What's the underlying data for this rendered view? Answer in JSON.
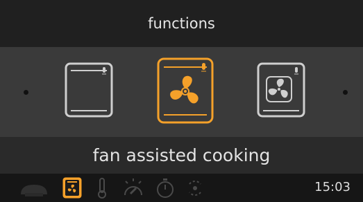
{
  "header": {
    "title": "functions"
  },
  "carousel": {
    "items": [
      {
        "icon": "top-bottom-heat-icon",
        "selected": false
      },
      {
        "icon": "fan-assisted-icon",
        "selected": true
      },
      {
        "icon": "fan-oven-icon",
        "selected": false
      }
    ],
    "selected_label": "fan assisted cooking"
  },
  "bottom_bar": {
    "icons": [
      "pot-icon",
      "function-icon",
      "thermometer-icon",
      "preheat-icon",
      "timer-icon",
      "eco-icon"
    ],
    "active_index": 1,
    "time": "15:03"
  },
  "colors": {
    "accent": "#f5a12a",
    "inactive": "#cfcfcf",
    "background": "#1c1c1c"
  }
}
